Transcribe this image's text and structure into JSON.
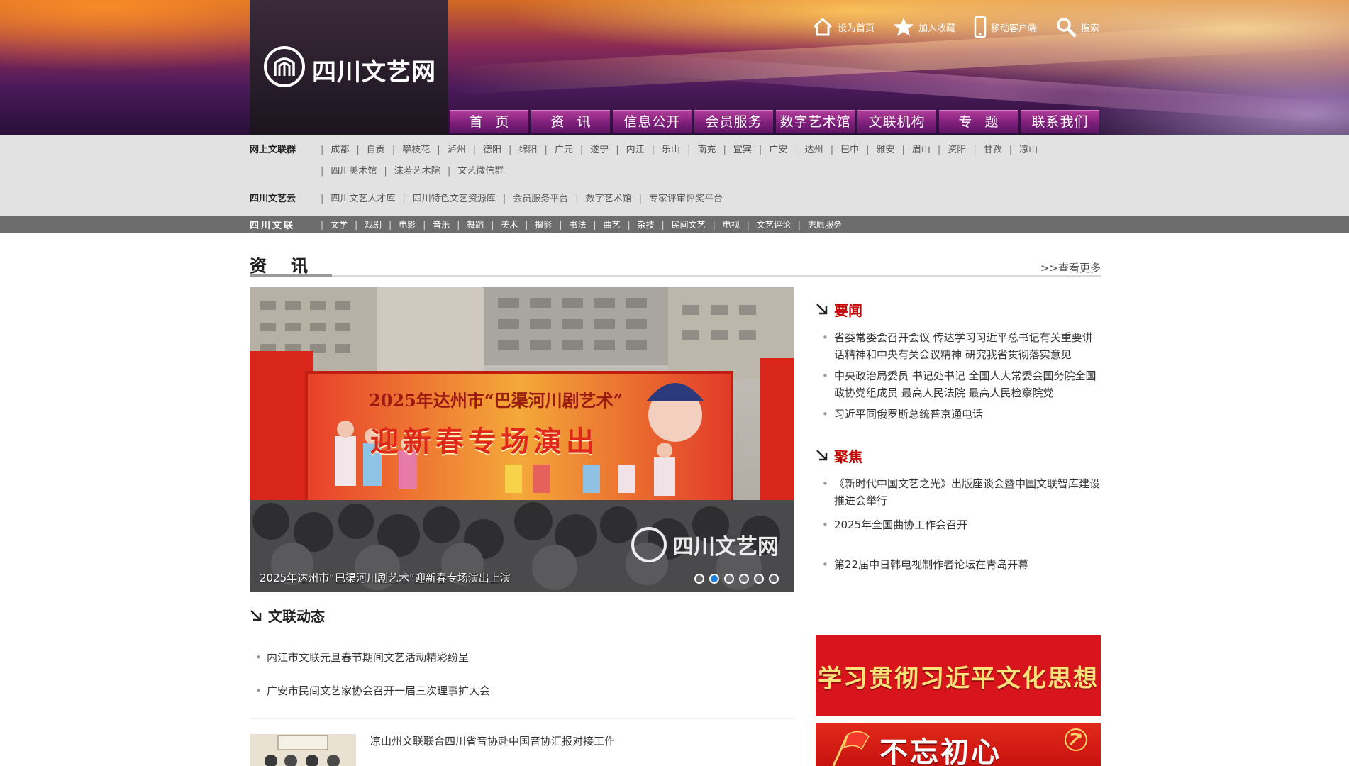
{
  "site": {
    "name": "四川文艺网"
  },
  "top_links": [
    {
      "label": "设为首页",
      "icon": "home-icon"
    },
    {
      "label": "加入收藏",
      "icon": "star-icon"
    },
    {
      "label": "移动客户端",
      "icon": "phone-icon"
    },
    {
      "label": "搜索",
      "icon": "search-icon"
    }
  ],
  "main_nav": [
    {
      "label": "首页"
    },
    {
      "label": "资讯"
    },
    {
      "label": "信息公开"
    },
    {
      "label": "会员服务"
    },
    {
      "label": "数字艺术馆"
    },
    {
      "label": "文联机构"
    },
    {
      "label": "专题"
    },
    {
      "label": "联系我们"
    }
  ],
  "subnav": {
    "row1_label": "网上文联群",
    "row1_items": [
      "成都",
      "自贡",
      "攀枝花",
      "泸州",
      "德阳",
      "绵阳",
      "广元",
      "遂宁",
      "内江",
      "乐山",
      "南充",
      "宜宾",
      "广安",
      "达州",
      "巴中",
      "雅安",
      "眉山",
      "资阳",
      "甘孜",
      "凉山",
      "四川美术馆",
      "沫若艺术院",
      "文艺微信群"
    ],
    "row2_label": "四川文艺云",
    "row2_items": [
      "四川文艺人才库",
      "四川特色文艺资源库",
      "会员服务平台",
      "数字艺术馆",
      "专家评审评奖平台"
    ],
    "row3_label": "四川文联",
    "row3_items": [
      "文学",
      "戏剧",
      "电影",
      "音乐",
      "舞蹈",
      "美术",
      "摄影",
      "书法",
      "曲艺",
      "杂技",
      "民间文艺",
      "电视",
      "文艺评论",
      "志愿服务"
    ]
  },
  "section": {
    "title": "资讯",
    "more": ">>查看更多"
  },
  "carousel": {
    "caption": "2025年达州市“巴渠河川剧艺术”迎新春专场演出上演",
    "banner_line1": "2025年达州市“巴渠河川剧艺术”",
    "banner_line2": "迎新春专场演出",
    "watermark": "四川文艺网",
    "dot_count": 6,
    "active_dot": 1
  },
  "news_groups": [
    {
      "title": "要闻",
      "items": [
        "省委常委会召开会议 传达学习习近平总书记有关重要讲话精神和中央有关会议精神 研究我省贯彻落实意见",
        "中央政治局委员 书记处书记 全国人大常委会国务院全国政协党组成员 最高人民法院 最高人民检察院党",
        "习近平同俄罗斯总统普京通电话"
      ]
    },
    {
      "title": "聚焦",
      "items": [
        "《新时代中国文艺之光》出版座谈会暨中国文联智库建设推进会举行",
        "2025年全国曲协工作会召开",
        "第22届中日韩电视制作者论坛在青岛开幕"
      ]
    }
  ],
  "dynamics": {
    "title": "文联动态",
    "items": [
      "内江市文联元旦春节期间文艺活动精彩纷呈",
      "广安市民间文艺家协会召开一届三次理事扩大会"
    ],
    "feature": "凉山州文联联合四川省音协赴中国音协汇报对接工作"
  },
  "banners": {
    "study": "学习贯彻习近平文化思想",
    "origin": "不忘初心"
  },
  "colors": {
    "accent_red": "#c40000",
    "nav_purple": "#7d1f7b",
    "subnav_gray": "#e2e2e2",
    "darkbar_gray": "#6d6d6d"
  }
}
